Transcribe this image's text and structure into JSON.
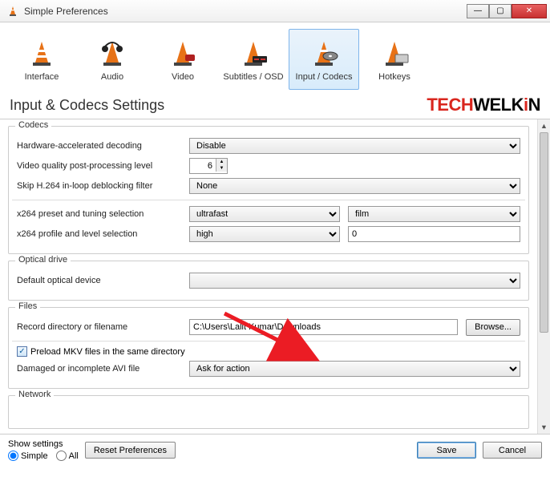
{
  "window": {
    "title": "Simple Preferences"
  },
  "tabs": [
    {
      "label": "Interface"
    },
    {
      "label": "Audio"
    },
    {
      "label": "Video"
    },
    {
      "label": "Subtitles / OSD"
    },
    {
      "label": "Input / Codecs"
    },
    {
      "label": "Hotkeys"
    }
  ],
  "heading": "Input & Codecs Settings",
  "brand": {
    "tech": "TECH",
    "welk": "WELK",
    "i": "i",
    "n": "N"
  },
  "codecs": {
    "title": "Codecs",
    "hw_decode_label": "Hardware-accelerated decoding",
    "hw_decode_value": "Disable",
    "vq_label": "Video quality post-processing level",
    "vq_value": "6",
    "skip_label": "Skip H.264 in-loop deblocking filter",
    "skip_value": "None",
    "x264_preset_label": "x264 preset and tuning selection",
    "x264_preset_value": "ultrafast",
    "x264_tuning_value": "film",
    "x264_profile_label": "x264 profile and level selection",
    "x264_profile_value": "high",
    "x264_level_value": "0"
  },
  "optical": {
    "title": "Optical drive",
    "default_label": "Default optical device",
    "default_value": ""
  },
  "files": {
    "title": "Files",
    "record_label": "Record directory or filename",
    "record_value": "C:\\Users\\Lalit Kumar\\Downloads",
    "browse_label": "Browse...",
    "preload_label": "Preload MKV files in the same directory",
    "preload_checked": true,
    "avi_label": "Damaged or incomplete AVI file",
    "avi_value": "Ask for action"
  },
  "network": {
    "title": "Network"
  },
  "footer": {
    "show_label": "Show settings",
    "simple_label": "Simple",
    "all_label": "All",
    "reset_label": "Reset Preferences",
    "save_label": "Save",
    "cancel_label": "Cancel"
  }
}
